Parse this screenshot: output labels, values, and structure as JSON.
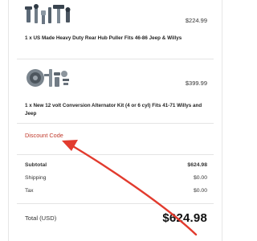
{
  "items": [
    {
      "image": "hub-puller-tools-image",
      "price": "$224.99",
      "title": "1 x US Made Heavy Duty Rear Hub Puller Fits 46-86 Jeep & Willys"
    },
    {
      "image": "alternator-kit-image",
      "price": "$399.99",
      "title": "1 x New 12 volt Conversion Alternator Kit (4 or 6 cyl) Fits 41-71 Willys and Jeep"
    }
  ],
  "discount": {
    "label": "Discount Code"
  },
  "summary": {
    "subtotal_label": "Subtotal",
    "subtotal_value": "$624.98",
    "shipping_label": "Shipping",
    "shipping_value": "$0.00",
    "tax_label": "Tax",
    "tax_value": "$0.00",
    "total_label": "Total (USD)",
    "total_value": "$624.98"
  },
  "colors": {
    "link": "#c0392b",
    "annotation_arrow": "#e23b2e",
    "divider": "#e4e4e4"
  }
}
